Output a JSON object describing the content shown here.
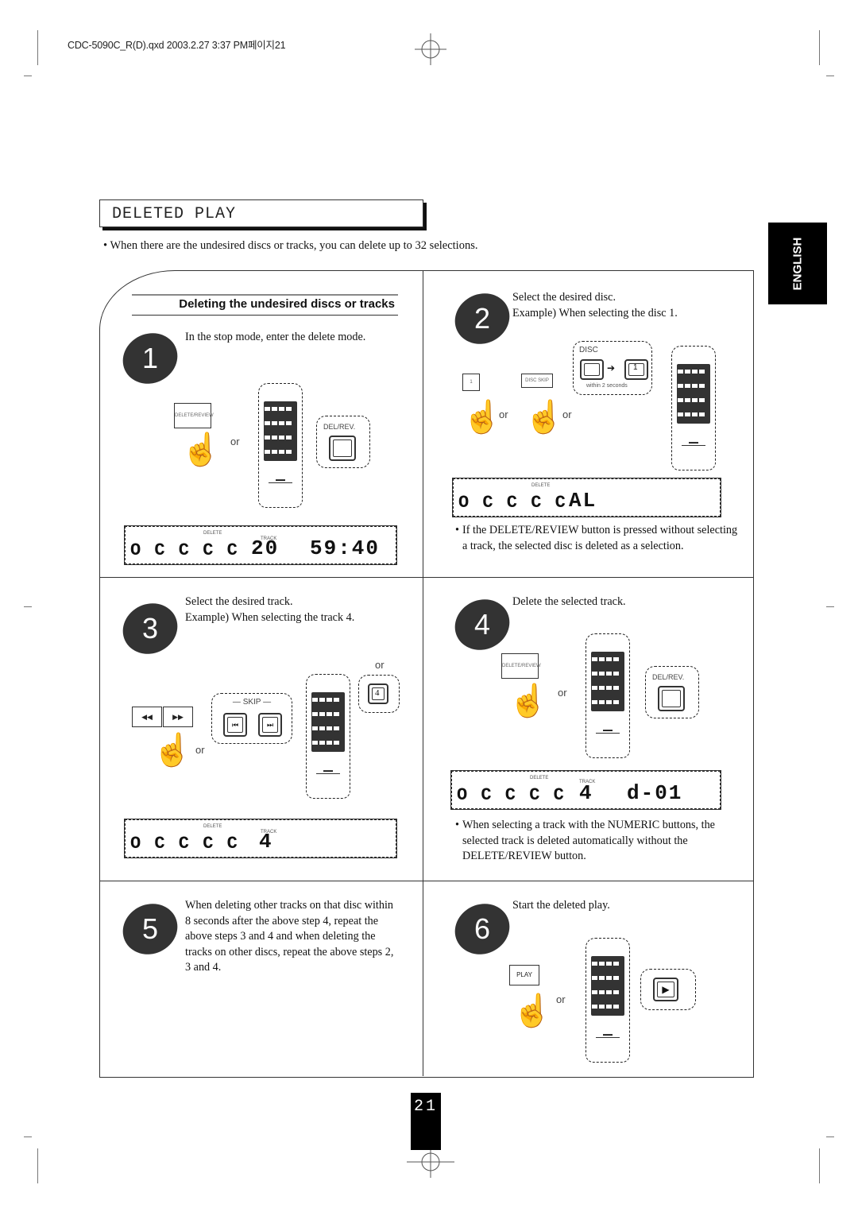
{
  "header": {
    "file_info": "CDC-5090C_R(D).qxd 2003.2.27 3:37 PM페이지21"
  },
  "title": "DELETED PLAY",
  "intro": "When there are the undesired discs or tracks, you can delete up to 32 selections.",
  "language_tab": "ENGLISH",
  "section_heading": "Deleting the undesired discs or tracks",
  "bullet": "•",
  "or_label": "or",
  "steps": [
    {
      "number": "1",
      "text": "In the stop mode, enter the delete mode.",
      "button_label": "DELETE/REVIEW",
      "callout_label": "DEL/REV.",
      "display": {
        "discs": "O C C C C",
        "indicator": "DELETE",
        "track_label": "TRACK",
        "main": "20",
        "time": "59:40"
      }
    },
    {
      "number": "2",
      "text": "Select the desired disc.",
      "text2": "Example) When selecting the disc 1.",
      "button1_label": "1",
      "button2_label": "DISC SKIP",
      "callout_label": "DISC",
      "callout_key": "1",
      "callout_note": "within 2 seconds",
      "display": {
        "discs": "O C C C C",
        "indicator": "DELETE",
        "main": "AL"
      },
      "note": "If the DELETE/REVIEW button is pressed without selecting a track, the selected disc is deleted as a selection."
    },
    {
      "number": "3",
      "text": "Select the desired track.",
      "text2": "Example) When selecting the track 4.",
      "callout_label": "SKIP",
      "callout_key": "4",
      "display": {
        "discs": "O C C C C",
        "indicator": "DELETE",
        "track_label": "TRACK",
        "main": "4"
      }
    },
    {
      "number": "4",
      "text": "Delete the selected track.",
      "button_label": "DELETE/REVIEW",
      "callout_label": "DEL/REV.",
      "display": {
        "discs": "O C C C C",
        "indicator": "DELETE",
        "track_label": "TRACK",
        "main": "4",
        "extra": "d-01"
      },
      "note": "When selecting a track with the NUMERIC buttons, the selected track is deleted automatically without the DELETE/REVIEW button."
    },
    {
      "number": "5",
      "text": "When deleting other tracks on that disc within 8 seconds after the above step 4, repeat the above steps 3 and 4 and when deleting the tracks on other discs, repeat the above steps 2, 3 and 4."
    },
    {
      "number": "6",
      "text": "Start the deleted play.",
      "button_label": "PLAY"
    }
  ],
  "page_number": "21"
}
